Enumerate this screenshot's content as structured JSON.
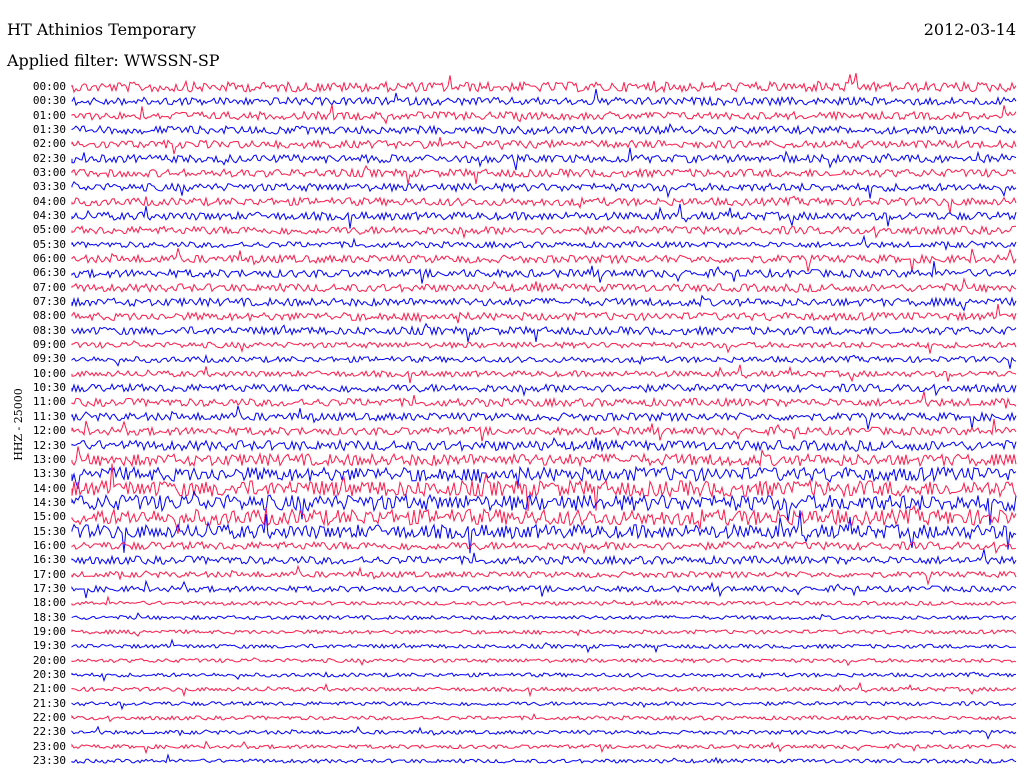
{
  "header": {
    "title": "HT Athinios Temporary",
    "date": "2012-03-14",
    "filter": "Applied filter: WWSSN-SP"
  },
  "chart_data": {
    "type": "helicorder",
    "channel_label": "HHZ - 25000",
    "row_labels": [
      "00:00",
      "00:30",
      "01:00",
      "01:30",
      "02:00",
      "02:30",
      "03:00",
      "03:30",
      "04:00",
      "04:30",
      "05:00",
      "05:30",
      "06:00",
      "06:30",
      "07:00",
      "07:30",
      "08:00",
      "08:30",
      "09:00",
      "09:30",
      "10:00",
      "10:30",
      "11:00",
      "11:30",
      "12:00",
      "12:30",
      "13:00",
      "13:30",
      "14:00",
      "14:30",
      "15:00",
      "15:30",
      "16:00",
      "16:30",
      "17:00",
      "17:30",
      "18:00",
      "18:30",
      "19:00",
      "19:30",
      "20:00",
      "20:30",
      "21:00",
      "21:30",
      "22:00",
      "22:30",
      "23:00",
      "23:30"
    ],
    "row_minutes": 30,
    "trace_colors": [
      "#ff1a4a",
      "#0000ff"
    ],
    "amplitude_profile": {
      "00:00": 5,
      "00:30": 4,
      "01:00": 4,
      "01:30": 4,
      "02:00": 4,
      "02:30": 4,
      "03:00": 4,
      "03:30": 4,
      "04:00": 4,
      "04:30": 4,
      "05:00": 4,
      "05:30": 3,
      "06:00": 4,
      "06:30": 4,
      "07:00": 4,
      "07:30": 4,
      "08:00": 4,
      "08:30": 4,
      "09:00": 3,
      "09:30": 3,
      "10:00": 3,
      "10:30": 4,
      "11:00": 4,
      "11:30": 4,
      "12:00": 4,
      "12:30": 5,
      "13:00": 6,
      "13:30": 7,
      "14:00": 8,
      "14:30": 8,
      "15:00": 8,
      "15:30": 7,
      "16:00": 4,
      "16:30": 4,
      "17:00": 3,
      "17:30": 3,
      "18:00": 2,
      "18:30": 2,
      "19:00": 2,
      "19:30": 2,
      "20:00": 2,
      "20:30": 2,
      "21:00": 2,
      "21:30": 2,
      "22:00": 2,
      "22:30": 2,
      "23:00": 2,
      "23:30": 2
    }
  }
}
